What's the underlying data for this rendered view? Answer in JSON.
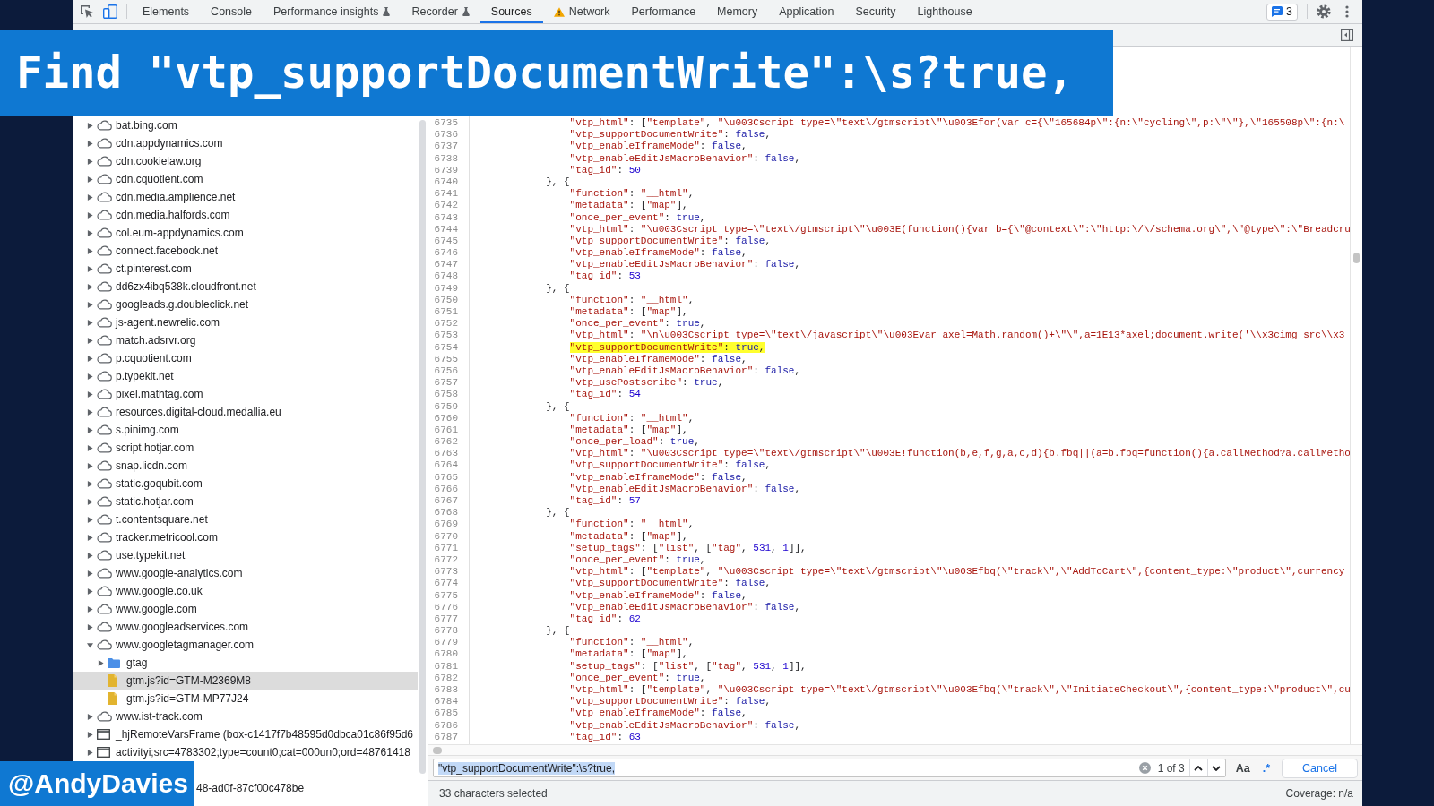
{
  "banner": {
    "text": "Find \"vtp_supportDocumentWrite\":\\s?true,"
  },
  "toolbar": {
    "tabs": [
      {
        "label": "Elements",
        "kind": "plain",
        "selected": false
      },
      {
        "label": "Console",
        "kind": "plain",
        "selected": false
      },
      {
        "label": "Performance insights",
        "kind": "experimental",
        "selected": false
      },
      {
        "label": "Recorder",
        "kind": "experimental",
        "selected": false
      },
      {
        "label": "Sources",
        "kind": "plain",
        "selected": true
      },
      {
        "label": "Network",
        "kind": "warning",
        "selected": false
      },
      {
        "label": "Performance",
        "kind": "plain",
        "selected": false
      },
      {
        "label": "Memory",
        "kind": "plain",
        "selected": false
      },
      {
        "label": "Application",
        "kind": "plain",
        "selected": false
      },
      {
        "label": "Security",
        "kind": "plain",
        "selected": false
      },
      {
        "label": "Lighthouse",
        "kind": "plain",
        "selected": false
      }
    ],
    "issues_count": "3"
  },
  "sidebar": {
    "items": [
      {
        "label": "bat.bing.com",
        "kind": "domain",
        "expanded": false,
        "selected": false
      },
      {
        "label": "cdn.appdynamics.com",
        "kind": "domain",
        "expanded": false,
        "selected": false
      },
      {
        "label": "cdn.cookielaw.org",
        "kind": "domain",
        "expanded": false,
        "selected": false
      },
      {
        "label": "cdn.cquotient.com",
        "kind": "domain",
        "expanded": false,
        "selected": false
      },
      {
        "label": "cdn.media.amplience.net",
        "kind": "domain",
        "expanded": false,
        "selected": false
      },
      {
        "label": "cdn.media.halfords.com",
        "kind": "domain",
        "expanded": false,
        "selected": false
      },
      {
        "label": "col.eum-appdynamics.com",
        "kind": "domain",
        "expanded": false,
        "selected": false
      },
      {
        "label": "connect.facebook.net",
        "kind": "domain",
        "expanded": false,
        "selected": false
      },
      {
        "label": "ct.pinterest.com",
        "kind": "domain",
        "expanded": false,
        "selected": false
      },
      {
        "label": "dd6zx4ibq538k.cloudfront.net",
        "kind": "domain",
        "expanded": false,
        "selected": false
      },
      {
        "label": "googleads.g.doubleclick.net",
        "kind": "domain",
        "expanded": false,
        "selected": false
      },
      {
        "label": "js-agent.newrelic.com",
        "kind": "domain",
        "expanded": false,
        "selected": false
      },
      {
        "label": "match.adsrvr.org",
        "kind": "domain",
        "expanded": false,
        "selected": false
      },
      {
        "label": "p.cquotient.com",
        "kind": "domain",
        "expanded": false,
        "selected": false
      },
      {
        "label": "p.typekit.net",
        "kind": "domain",
        "expanded": false,
        "selected": false
      },
      {
        "label": "pixel.mathtag.com",
        "kind": "domain",
        "expanded": false,
        "selected": false
      },
      {
        "label": "resources.digital-cloud.medallia.eu",
        "kind": "domain",
        "expanded": false,
        "selected": false
      },
      {
        "label": "s.pinimg.com",
        "kind": "domain",
        "expanded": false,
        "selected": false
      },
      {
        "label": "script.hotjar.com",
        "kind": "domain",
        "expanded": false,
        "selected": false
      },
      {
        "label": "snap.licdn.com",
        "kind": "domain",
        "expanded": false,
        "selected": false
      },
      {
        "label": "static.goqubit.com",
        "kind": "domain",
        "expanded": false,
        "selected": false
      },
      {
        "label": "static.hotjar.com",
        "kind": "domain",
        "expanded": false,
        "selected": false
      },
      {
        "label": "t.contentsquare.net",
        "kind": "domain",
        "expanded": false,
        "selected": false
      },
      {
        "label": "tracker.metricool.com",
        "kind": "domain",
        "expanded": false,
        "selected": false
      },
      {
        "label": "use.typekit.net",
        "kind": "domain",
        "expanded": false,
        "selected": false
      },
      {
        "label": "www.google-analytics.com",
        "kind": "domain",
        "expanded": false,
        "selected": false
      },
      {
        "label": "www.google.co.uk",
        "kind": "domain",
        "expanded": false,
        "selected": false
      },
      {
        "label": "www.google.com",
        "kind": "domain",
        "expanded": false,
        "selected": false
      },
      {
        "label": "www.googleadservices.com",
        "kind": "domain",
        "expanded": false,
        "selected": false
      },
      {
        "label": "www.googletagmanager.com",
        "kind": "domain",
        "expanded": true,
        "selected": false,
        "children": [
          {
            "label": "gtag",
            "kind": "folder",
            "expanded": false,
            "selected": false
          },
          {
            "label": "gtm.js?id=GTM-M2369M8",
            "kind": "file",
            "selected": true
          },
          {
            "label": "gtm.js?id=GTM-MP77J24",
            "kind": "file",
            "selected": false
          }
        ]
      },
      {
        "label": "www.ist-track.com",
        "kind": "domain",
        "expanded": false,
        "selected": false
      },
      {
        "label": "_hjRemoteVarsFrame (box-c1417f7b48595d0dbca01c86f95d6",
        "kind": "frame",
        "expanded": false,
        "selected": false
      },
      {
        "label": "activityi;src=4783302;type=count0;cat=000un0;ord=48761418",
        "kind": "frame",
        "expanded": false,
        "selected": false
      },
      {
        "label": "48-ad0f-87cf00c478be",
        "kind": "clipped",
        "selected": false
      }
    ]
  },
  "editor": {
    "lines": [
      {
        "number": "6735",
        "kind": "member",
        "highlighted": false,
        "tokens": [
          {
            "kind": "string",
            "text": "\"vtp_html\""
          },
          {
            "kind": "punct",
            "text": ": ["
          },
          {
            "kind": "string",
            "text": "\"template\""
          },
          {
            "kind": "punct",
            "text": ", "
          },
          {
            "kind": "string",
            "text": "\"\\u003Cscript type=\\\"text\\/gtmscript\\\"\\u003Efor(var c={\\\"165684p\\\":{n:\\\"cycling\\\",p:\\\"\\\"},\\\"165508p\\\":{n:\\"
          }
        ]
      },
      {
        "number": "6736",
        "kind": "member",
        "highlighted": false,
        "tokens": [
          {
            "kind": "string",
            "text": "\"vtp_supportDocumentWrite\""
          },
          {
            "kind": "punct",
            "text": ": "
          },
          {
            "kind": "keyword",
            "text": "false"
          },
          {
            "kind": "punct",
            "text": ","
          }
        ]
      },
      {
        "number": "6737",
        "kind": "member",
        "highlighted": false,
        "tokens": [
          {
            "kind": "string",
            "text": "\"vtp_enableIframeMode\""
          },
          {
            "kind": "punct",
            "text": ": "
          },
          {
            "kind": "keyword",
            "text": "false"
          },
          {
            "kind": "punct",
            "text": ","
          }
        ]
      },
      {
        "number": "6738",
        "kind": "member",
        "highlighted": false,
        "tokens": [
          {
            "kind": "string",
            "text": "\"vtp_enableEditJsMacroBehavior\""
          },
          {
            "kind": "punct",
            "text": ": "
          },
          {
            "kind": "keyword",
            "text": "false"
          },
          {
            "kind": "punct",
            "text": ","
          }
        ]
      },
      {
        "number": "6739",
        "kind": "member",
        "highlighted": false,
        "tokens": [
          {
            "kind": "string",
            "text": "\"tag_id\""
          },
          {
            "kind": "punct",
            "text": ": "
          },
          {
            "kind": "number",
            "text": "50"
          }
        ]
      },
      {
        "number": "6740",
        "kind": "brace",
        "highlighted": false,
        "tokens": [
          {
            "kind": "punct",
            "text": "}, {"
          }
        ]
      },
      {
        "number": "6741",
        "kind": "member",
        "highlighted": false,
        "tokens": [
          {
            "kind": "string",
            "text": "\"function\""
          },
          {
            "kind": "punct",
            "text": ": "
          },
          {
            "kind": "string",
            "text": "\"__html\""
          },
          {
            "kind": "punct",
            "text": ","
          }
        ]
      },
      {
        "number": "6742",
        "kind": "member",
        "highlighted": false,
        "tokens": [
          {
            "kind": "string",
            "text": "\"metadata\""
          },
          {
            "kind": "punct",
            "text": ": ["
          },
          {
            "kind": "string",
            "text": "\"map\""
          },
          {
            "kind": "punct",
            "text": "],"
          }
        ]
      },
      {
        "number": "6743",
        "kind": "member",
        "highlighted": false,
        "tokens": [
          {
            "kind": "string",
            "text": "\"once_per_event\""
          },
          {
            "kind": "punct",
            "text": ": "
          },
          {
            "kind": "keyword",
            "text": "true"
          },
          {
            "kind": "punct",
            "text": ","
          }
        ]
      },
      {
        "number": "6744",
        "kind": "member",
        "highlighted": false,
        "tokens": [
          {
            "kind": "string",
            "text": "\"vtp_html\""
          },
          {
            "kind": "punct",
            "text": ": "
          },
          {
            "kind": "string",
            "text": "\"\\u003Cscript type=\\\"text\\/gtmscript\\\"\\u003E(function(){var b={\\\"@context\\\":\\\"http:\\/\\/schema.org\\\",\\\"@type\\\":\\\"Breadcru"
          }
        ]
      },
      {
        "number": "6745",
        "kind": "member",
        "highlighted": false,
        "tokens": [
          {
            "kind": "string",
            "text": "\"vtp_supportDocumentWrite\""
          },
          {
            "kind": "punct",
            "text": ": "
          },
          {
            "kind": "keyword",
            "text": "false"
          },
          {
            "kind": "punct",
            "text": ","
          }
        ]
      },
      {
        "number": "6746",
        "kind": "member",
        "highlighted": false,
        "tokens": [
          {
            "kind": "string",
            "text": "\"vtp_enableIframeMode\""
          },
          {
            "kind": "punct",
            "text": ": "
          },
          {
            "kind": "keyword",
            "text": "false"
          },
          {
            "kind": "punct",
            "text": ","
          }
        ]
      },
      {
        "number": "6747",
        "kind": "member",
        "highlighted": false,
        "tokens": [
          {
            "kind": "string",
            "text": "\"vtp_enableEditJsMacroBehavior\""
          },
          {
            "kind": "punct",
            "text": ": "
          },
          {
            "kind": "keyword",
            "text": "false"
          },
          {
            "kind": "punct",
            "text": ","
          }
        ]
      },
      {
        "number": "6748",
        "kind": "member",
        "highlighted": false,
        "tokens": [
          {
            "kind": "string",
            "text": "\"tag_id\""
          },
          {
            "kind": "punct",
            "text": ": "
          },
          {
            "kind": "number",
            "text": "53"
          }
        ]
      },
      {
        "number": "6749",
        "kind": "brace",
        "highlighted": false,
        "tokens": [
          {
            "kind": "punct",
            "text": "}, {"
          }
        ]
      },
      {
        "number": "6750",
        "kind": "member",
        "highlighted": false,
        "tokens": [
          {
            "kind": "string",
            "text": "\"function\""
          },
          {
            "kind": "punct",
            "text": ": "
          },
          {
            "kind": "string",
            "text": "\"__html\""
          },
          {
            "kind": "punct",
            "text": ","
          }
        ]
      },
      {
        "number": "6751",
        "kind": "member",
        "highlighted": false,
        "tokens": [
          {
            "kind": "string",
            "text": "\"metadata\""
          },
          {
            "kind": "punct",
            "text": ": ["
          },
          {
            "kind": "string",
            "text": "\"map\""
          },
          {
            "kind": "punct",
            "text": "],"
          }
        ]
      },
      {
        "number": "6752",
        "kind": "member",
        "highlighted": false,
        "tokens": [
          {
            "kind": "string",
            "text": "\"once_per_event\""
          },
          {
            "kind": "punct",
            "text": ": "
          },
          {
            "kind": "keyword",
            "text": "true"
          },
          {
            "kind": "punct",
            "text": ","
          }
        ]
      },
      {
        "number": "6753",
        "kind": "member",
        "highlighted": false,
        "tokens": [
          {
            "kind": "string",
            "text": "\"vtp_html\""
          },
          {
            "kind": "punct",
            "text": ": "
          },
          {
            "kind": "string",
            "text": "\"\\n\\u003Cscript type=\\\"text\\/javascript\\\"\\u003Evar axel=Math.random()+\\\"\\\",a=1E13*axel;document.write('\\\\x3cimg src\\\\x3"
          }
        ]
      },
      {
        "number": "6754",
        "kind": "member",
        "highlighted": true,
        "tokens": [
          {
            "kind": "string",
            "text": "\"vtp_supportDocumentWrite\""
          },
          {
            "kind": "punct",
            "text": ": "
          },
          {
            "kind": "keyword",
            "text": "true"
          },
          {
            "kind": "punct",
            "text": ","
          }
        ]
      },
      {
        "number": "6755",
        "kind": "member",
        "highlighted": false,
        "tokens": [
          {
            "kind": "string",
            "text": "\"vtp_enableIframeMode\""
          },
          {
            "kind": "punct",
            "text": ": "
          },
          {
            "kind": "keyword",
            "text": "false"
          },
          {
            "kind": "punct",
            "text": ","
          }
        ]
      },
      {
        "number": "6756",
        "kind": "member",
        "highlighted": false,
        "tokens": [
          {
            "kind": "string",
            "text": "\"vtp_enableEditJsMacroBehavior\""
          },
          {
            "kind": "punct",
            "text": ": "
          },
          {
            "kind": "keyword",
            "text": "false"
          },
          {
            "kind": "punct",
            "text": ","
          }
        ]
      },
      {
        "number": "6757",
        "kind": "member",
        "highlighted": false,
        "tokens": [
          {
            "kind": "string",
            "text": "\"vtp_usePostscribe\""
          },
          {
            "kind": "punct",
            "text": ": "
          },
          {
            "kind": "keyword",
            "text": "true"
          },
          {
            "kind": "punct",
            "text": ","
          }
        ]
      },
      {
        "number": "6758",
        "kind": "member",
        "highlighted": false,
        "tokens": [
          {
            "kind": "string",
            "text": "\"tag_id\""
          },
          {
            "kind": "punct",
            "text": ": "
          },
          {
            "kind": "number",
            "text": "54"
          }
        ]
      },
      {
        "number": "6759",
        "kind": "brace",
        "highlighted": false,
        "tokens": [
          {
            "kind": "punct",
            "text": "}, {"
          }
        ]
      },
      {
        "number": "6760",
        "kind": "member",
        "highlighted": false,
        "tokens": [
          {
            "kind": "string",
            "text": "\"function\""
          },
          {
            "kind": "punct",
            "text": ": "
          },
          {
            "kind": "string",
            "text": "\"__html\""
          },
          {
            "kind": "punct",
            "text": ","
          }
        ]
      },
      {
        "number": "6761",
        "kind": "member",
        "highlighted": false,
        "tokens": [
          {
            "kind": "string",
            "text": "\"metadata\""
          },
          {
            "kind": "punct",
            "text": ": ["
          },
          {
            "kind": "string",
            "text": "\"map\""
          },
          {
            "kind": "punct",
            "text": "],"
          }
        ]
      },
      {
        "number": "6762",
        "kind": "member",
        "highlighted": false,
        "tokens": [
          {
            "kind": "string",
            "text": "\"once_per_load\""
          },
          {
            "kind": "punct",
            "text": ": "
          },
          {
            "kind": "keyword",
            "text": "true"
          },
          {
            "kind": "punct",
            "text": ","
          }
        ]
      },
      {
        "number": "6763",
        "kind": "member",
        "highlighted": false,
        "tokens": [
          {
            "kind": "string",
            "text": "\"vtp_html\""
          },
          {
            "kind": "punct",
            "text": ": "
          },
          {
            "kind": "string",
            "text": "\"\\u003Cscript type=\\\"text\\/gtmscript\\\"\\u003E!function(b,e,f,g,a,c,d){b.fbq||(a=b.fbq=function(){a.callMethod?a.callMetho"
          }
        ]
      },
      {
        "number": "6764",
        "kind": "member",
        "highlighted": false,
        "tokens": [
          {
            "kind": "string",
            "text": "\"vtp_supportDocumentWrite\""
          },
          {
            "kind": "punct",
            "text": ": "
          },
          {
            "kind": "keyword",
            "text": "false"
          },
          {
            "kind": "punct",
            "text": ","
          }
        ]
      },
      {
        "number": "6765",
        "kind": "member",
        "highlighted": false,
        "tokens": [
          {
            "kind": "string",
            "text": "\"vtp_enableIframeMode\""
          },
          {
            "kind": "punct",
            "text": ": "
          },
          {
            "kind": "keyword",
            "text": "false"
          },
          {
            "kind": "punct",
            "text": ","
          }
        ]
      },
      {
        "number": "6766",
        "kind": "member",
        "highlighted": false,
        "tokens": [
          {
            "kind": "string",
            "text": "\"vtp_enableEditJsMacroBehavior\""
          },
          {
            "kind": "punct",
            "text": ": "
          },
          {
            "kind": "keyword",
            "text": "false"
          },
          {
            "kind": "punct",
            "text": ","
          }
        ]
      },
      {
        "number": "6767",
        "kind": "member",
        "highlighted": false,
        "tokens": [
          {
            "kind": "string",
            "text": "\"tag_id\""
          },
          {
            "kind": "punct",
            "text": ": "
          },
          {
            "kind": "number",
            "text": "57"
          }
        ]
      },
      {
        "number": "6768",
        "kind": "brace",
        "highlighted": false,
        "tokens": [
          {
            "kind": "punct",
            "text": "}, {"
          }
        ]
      },
      {
        "number": "6769",
        "kind": "member",
        "highlighted": false,
        "tokens": [
          {
            "kind": "string",
            "text": "\"function\""
          },
          {
            "kind": "punct",
            "text": ": "
          },
          {
            "kind": "string",
            "text": "\"__html\""
          },
          {
            "kind": "punct",
            "text": ","
          }
        ]
      },
      {
        "number": "6770",
        "kind": "member",
        "highlighted": false,
        "tokens": [
          {
            "kind": "string",
            "text": "\"metadata\""
          },
          {
            "kind": "punct",
            "text": ": ["
          },
          {
            "kind": "string",
            "text": "\"map\""
          },
          {
            "kind": "punct",
            "text": "],"
          }
        ]
      },
      {
        "number": "6771",
        "kind": "member",
        "highlighted": false,
        "tokens": [
          {
            "kind": "string",
            "text": "\"setup_tags\""
          },
          {
            "kind": "punct",
            "text": ": ["
          },
          {
            "kind": "string",
            "text": "\"list\""
          },
          {
            "kind": "punct",
            "text": ", ["
          },
          {
            "kind": "string",
            "text": "\"tag\""
          },
          {
            "kind": "punct",
            "text": ", "
          },
          {
            "kind": "number",
            "text": "531"
          },
          {
            "kind": "punct",
            "text": ", "
          },
          {
            "kind": "number",
            "text": "1"
          },
          {
            "kind": "punct",
            "text": "]],"
          }
        ]
      },
      {
        "number": "6772",
        "kind": "member",
        "highlighted": false,
        "tokens": [
          {
            "kind": "string",
            "text": "\"once_per_event\""
          },
          {
            "kind": "punct",
            "text": ": "
          },
          {
            "kind": "keyword",
            "text": "true"
          },
          {
            "kind": "punct",
            "text": ","
          }
        ]
      },
      {
        "number": "6773",
        "kind": "member",
        "highlighted": false,
        "tokens": [
          {
            "kind": "string",
            "text": "\"vtp_html\""
          },
          {
            "kind": "punct",
            "text": ": ["
          },
          {
            "kind": "string",
            "text": "\"template\""
          },
          {
            "kind": "punct",
            "text": ", "
          },
          {
            "kind": "string",
            "text": "\"\\u003Cscript type=\\\"text\\/gtmscript\\\"\\u003Efbq(\\\"track\\\",\\\"AddToCart\\\",{content_type:\\\"product\\\",currency"
          }
        ]
      },
      {
        "number": "6774",
        "kind": "member",
        "highlighted": false,
        "tokens": [
          {
            "kind": "string",
            "text": "\"vtp_supportDocumentWrite\""
          },
          {
            "kind": "punct",
            "text": ": "
          },
          {
            "kind": "keyword",
            "text": "false"
          },
          {
            "kind": "punct",
            "text": ","
          }
        ]
      },
      {
        "number": "6775",
        "kind": "member",
        "highlighted": false,
        "tokens": [
          {
            "kind": "string",
            "text": "\"vtp_enableIframeMode\""
          },
          {
            "kind": "punct",
            "text": ": "
          },
          {
            "kind": "keyword",
            "text": "false"
          },
          {
            "kind": "punct",
            "text": ","
          }
        ]
      },
      {
        "number": "6776",
        "kind": "member",
        "highlighted": false,
        "tokens": [
          {
            "kind": "string",
            "text": "\"vtp_enableEditJsMacroBehavior\""
          },
          {
            "kind": "punct",
            "text": ": "
          },
          {
            "kind": "keyword",
            "text": "false"
          },
          {
            "kind": "punct",
            "text": ","
          }
        ]
      },
      {
        "number": "6777",
        "kind": "member",
        "highlighted": false,
        "tokens": [
          {
            "kind": "string",
            "text": "\"tag_id\""
          },
          {
            "kind": "punct",
            "text": ": "
          },
          {
            "kind": "number",
            "text": "62"
          }
        ]
      },
      {
        "number": "6778",
        "kind": "brace",
        "highlighted": false,
        "tokens": [
          {
            "kind": "punct",
            "text": "}, {"
          }
        ]
      },
      {
        "number": "6779",
        "kind": "member",
        "highlighted": false,
        "tokens": [
          {
            "kind": "string",
            "text": "\"function\""
          },
          {
            "kind": "punct",
            "text": ": "
          },
          {
            "kind": "string",
            "text": "\"__html\""
          },
          {
            "kind": "punct",
            "text": ","
          }
        ]
      },
      {
        "number": "6780",
        "kind": "member",
        "highlighted": false,
        "tokens": [
          {
            "kind": "string",
            "text": "\"metadata\""
          },
          {
            "kind": "punct",
            "text": ": ["
          },
          {
            "kind": "string",
            "text": "\"map\""
          },
          {
            "kind": "punct",
            "text": "],"
          }
        ]
      },
      {
        "number": "6781",
        "kind": "member",
        "highlighted": false,
        "tokens": [
          {
            "kind": "string",
            "text": "\"setup_tags\""
          },
          {
            "kind": "punct",
            "text": ": ["
          },
          {
            "kind": "string",
            "text": "\"list\""
          },
          {
            "kind": "punct",
            "text": ", ["
          },
          {
            "kind": "string",
            "text": "\"tag\""
          },
          {
            "kind": "punct",
            "text": ", "
          },
          {
            "kind": "number",
            "text": "531"
          },
          {
            "kind": "punct",
            "text": ", "
          },
          {
            "kind": "number",
            "text": "1"
          },
          {
            "kind": "punct",
            "text": "]],"
          }
        ]
      },
      {
        "number": "6782",
        "kind": "member",
        "highlighted": false,
        "tokens": [
          {
            "kind": "string",
            "text": "\"once_per_event\""
          },
          {
            "kind": "punct",
            "text": ": "
          },
          {
            "kind": "keyword",
            "text": "true"
          },
          {
            "kind": "punct",
            "text": ","
          }
        ]
      },
      {
        "number": "6783",
        "kind": "member",
        "highlighted": false,
        "tokens": [
          {
            "kind": "string",
            "text": "\"vtp_html\""
          },
          {
            "kind": "punct",
            "text": ": ["
          },
          {
            "kind": "string",
            "text": "\"template\""
          },
          {
            "kind": "punct",
            "text": ", "
          },
          {
            "kind": "string",
            "text": "\"\\u003Cscript type=\\\"text\\/gtmscript\\\"\\u003Efbq(\\\"track\\\",\\\"InitiateCheckout\\\",{content_type:\\\"product\\\",cu"
          }
        ]
      },
      {
        "number": "6784",
        "kind": "member",
        "highlighted": false,
        "tokens": [
          {
            "kind": "string",
            "text": "\"vtp_supportDocumentWrite\""
          },
          {
            "kind": "punct",
            "text": ": "
          },
          {
            "kind": "keyword",
            "text": "false"
          },
          {
            "kind": "punct",
            "text": ","
          }
        ]
      },
      {
        "number": "6785",
        "kind": "member",
        "highlighted": false,
        "tokens": [
          {
            "kind": "string",
            "text": "\"vtp_enableIframeMode\""
          },
          {
            "kind": "punct",
            "text": ": "
          },
          {
            "kind": "keyword",
            "text": "false"
          },
          {
            "kind": "punct",
            "text": ","
          }
        ]
      },
      {
        "number": "6786",
        "kind": "member",
        "highlighted": false,
        "tokens": [
          {
            "kind": "string",
            "text": "\"vtp_enableEditJsMacroBehavior\""
          },
          {
            "kind": "punct",
            "text": ": "
          },
          {
            "kind": "keyword",
            "text": "false"
          },
          {
            "kind": "punct",
            "text": ","
          }
        ]
      },
      {
        "number": "6787",
        "kind": "member",
        "highlighted": false,
        "tokens": [
          {
            "kind": "string",
            "text": "\"tag_id\""
          },
          {
            "kind": "punct",
            "text": ": "
          },
          {
            "kind": "number",
            "text": "63"
          }
        ]
      }
    ]
  },
  "search": {
    "query": "\"vtp_supportDocumentWrite\":\\s?true,",
    "selected": true,
    "match_count": "1 of 3",
    "match_case": {
      "label": "Aa",
      "on": false
    },
    "regex": {
      "label": ".*",
      "on": true
    },
    "cancel": "Cancel"
  },
  "status_bar": {
    "selection": "33 characters selected",
    "coverage": "Coverage: n/a"
  },
  "credit": {
    "text": "@AndyDavies"
  }
}
